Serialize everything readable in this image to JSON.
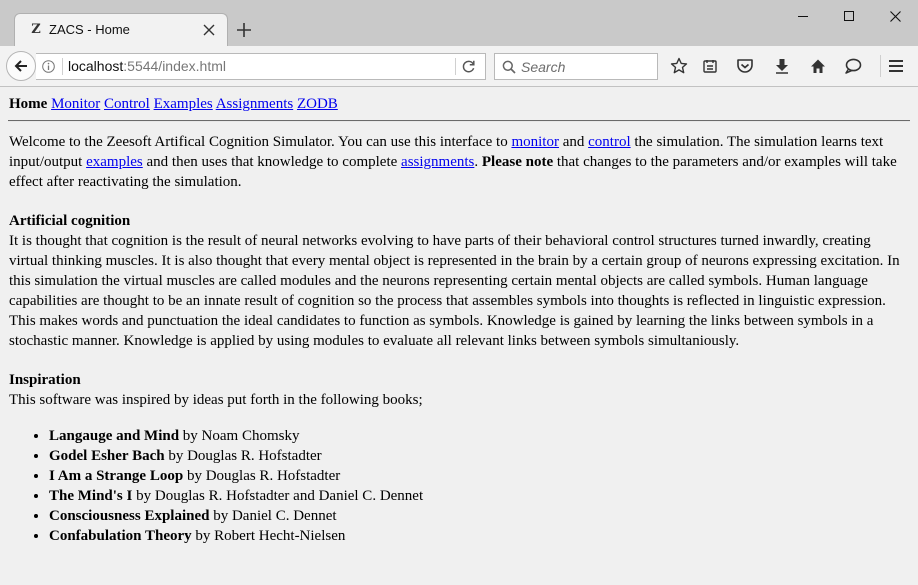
{
  "browser": {
    "tab_title": "ZACS - Home",
    "favicon_glyph": "Z",
    "url_host": "localhost",
    "url_rest": ":5544/index.html",
    "search_placeholder": "Search"
  },
  "page": {
    "nav": {
      "current": "Home",
      "links": [
        "Monitor",
        "Control",
        "Examples",
        "Assignments",
        "ZODB"
      ]
    },
    "intro": {
      "p1": "Welcome to the Zeesoft Artifical Cognition Simulator. You can use this interface to ",
      "link_monitor": "monitor",
      "and": " and ",
      "link_control": "control",
      "p2": " the simulation. The simulation learns text input/output ",
      "link_examples": "examples",
      "p3": " and then uses that knowledge to complete ",
      "link_assignments": "assignments",
      "p4": ". ",
      "note_bold": "Please note",
      "p5": " that changes to the parameters and/or examples will take effect after reactivating the simulation."
    },
    "cognition": {
      "heading": "Artificial cognition",
      "body": "It is thought that cognition is the result of neural networks evolving to have parts of their behavioral control structures turned inwardly, creating virtual thinking muscles. It is also thought that every mental object is represented in the brain by a certain group of neurons expressing excitation. In this simulation the virtual muscles are called modules and the neurons representing certain mental objects are called symbols. Human language capabilities are thought to be an innate result of cognition so the process that assembles symbols into thoughts is reflected in linguistic expression. This makes words and punctuation the ideal candidates to function as symbols. Knowledge is gained by learning the links between symbols in a stochastic manner. Knowledge is applied by using modules to evaluate all relevant links between symbols simultaniously."
    },
    "inspiration": {
      "heading": "Inspiration",
      "intro": "This software was inspired by ideas put forth in the following books;",
      "books": [
        {
          "title": "Langauge and Mind",
          "by": " by Noam Chomsky"
        },
        {
          "title": "Godel Esher Bach",
          "by": " by Douglas R. Hofstadter"
        },
        {
          "title": "I Am a Strange Loop",
          "by": " by Douglas R. Hofstadter"
        },
        {
          "title": "The Mind's I",
          "by": " by Douglas R. Hofstadter and Daniel C. Dennet"
        },
        {
          "title": "Consciousness Explained",
          "by": " by Daniel C. Dennet"
        },
        {
          "title": "Confabulation Theory",
          "by": " by Robert Hecht-Nielsen"
        }
      ]
    }
  }
}
